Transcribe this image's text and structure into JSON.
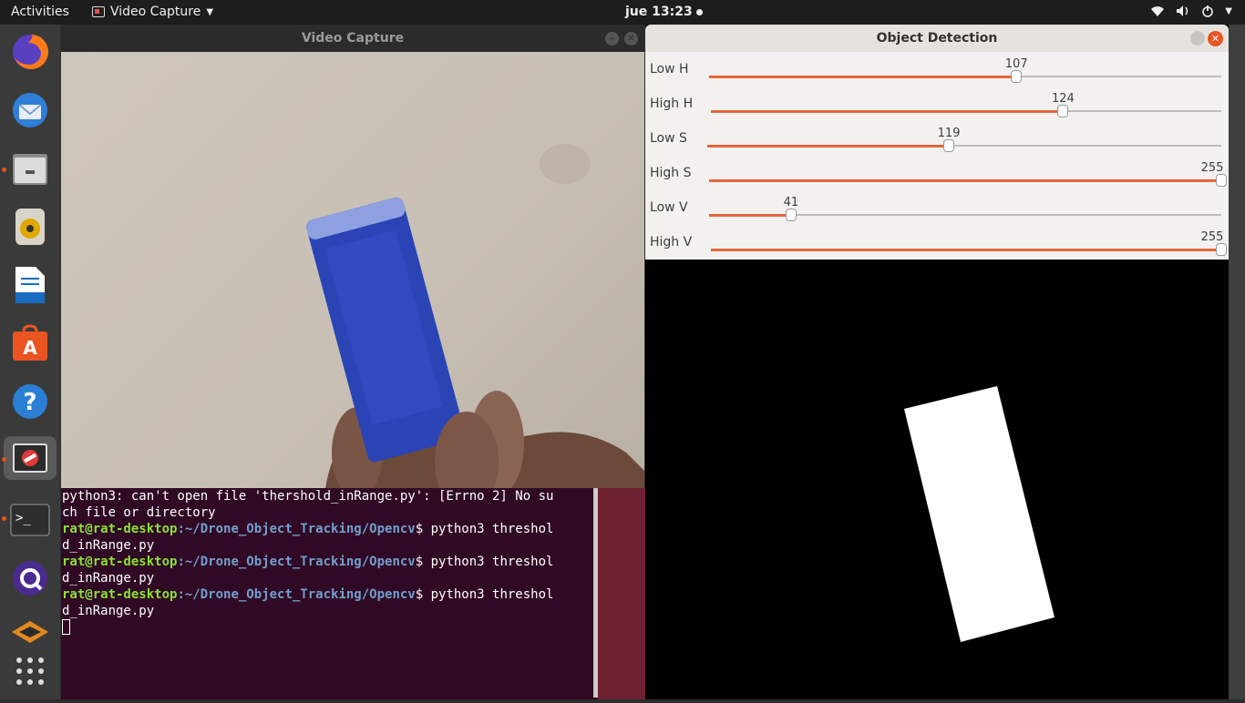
{
  "topbar": {
    "activities": "Activities",
    "app_name": "Video Capture",
    "clock": "jue 13:23"
  },
  "dock": {
    "items": [
      "firefox-icon",
      "thunderbird-icon",
      "files-icon",
      "rhythmbox-icon",
      "writer-icon",
      "software-center-icon",
      "help-icon",
      "no-entry-icon",
      "terminal-icon",
      "qgroundcontrol-icon",
      "layers-icon",
      "apps-grid-icon"
    ]
  },
  "video_capture": {
    "title": "Video Capture"
  },
  "object_detection": {
    "title": "Object Detection",
    "sliders": [
      {
        "label": "Low H",
        "value": "107",
        "fraction": 0.6
      },
      {
        "label": "High H",
        "value": "124",
        "fraction": 0.69
      },
      {
        "label": "Low S",
        "value": "119",
        "fraction": 0.47
      },
      {
        "label": "High S",
        "value": "255",
        "fraction": 1.0
      },
      {
        "label": "Low V",
        "value": "41",
        "fraction": 0.16
      },
      {
        "label": "High V",
        "value": "255",
        "fraction": 1.0
      }
    ]
  },
  "terminal": {
    "line1": "python3: can't open file 'thershold_inRange.py': [Errno 2] No su",
    "line2": "ch file or directory",
    "prompt_user": "rat@rat-desktop",
    "prompt_path": ":~/Drone_Object_Tracking/Opencv",
    "prompt_end": "$ python3 threshol",
    "wrap": "d_inRange.py"
  },
  "colors": {
    "accent": "#e95420",
    "terminal_bg": "#300a24",
    "prompt_user": "#8ae234",
    "prompt_path": "#729fcf"
  }
}
